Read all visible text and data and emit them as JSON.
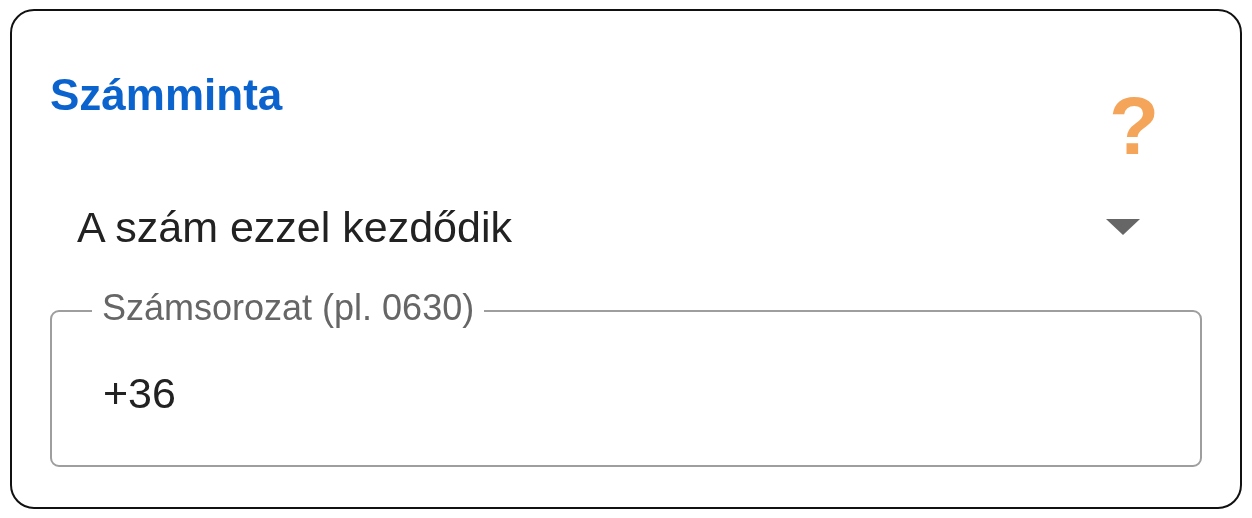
{
  "title": "Számminta",
  "help": {
    "symbol": "?"
  },
  "select": {
    "value": "A szám ezzel kezdődik"
  },
  "field": {
    "label": "Számsorozat (pl. 0630)",
    "value": "+36"
  }
}
